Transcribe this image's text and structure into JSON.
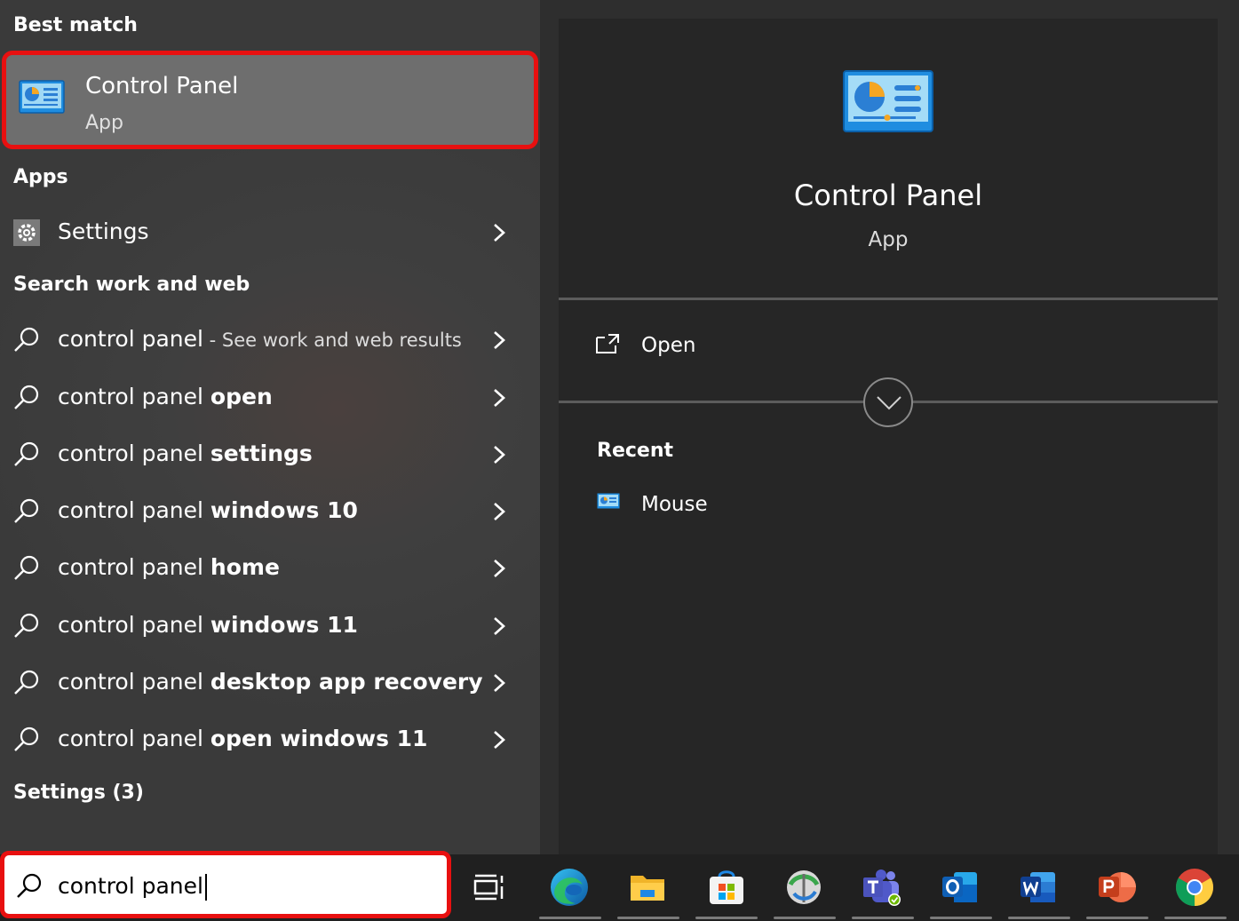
{
  "left_pane": {
    "best_match_header": "Best match",
    "best_match": {
      "title": "Control Panel",
      "subtitle": "App"
    },
    "apps_header": "Apps",
    "apps": [
      {
        "label": "Settings"
      }
    ],
    "web_header": "Search work and web",
    "web_results": [
      {
        "prefix": "control panel",
        "bold": "",
        "hint": " - See work and web results"
      },
      {
        "prefix": "control panel ",
        "bold": "open",
        "hint": ""
      },
      {
        "prefix": "control panel ",
        "bold": "settings",
        "hint": ""
      },
      {
        "prefix": "control panel ",
        "bold": "windows 10",
        "hint": ""
      },
      {
        "prefix": "control panel ",
        "bold": "home",
        "hint": ""
      },
      {
        "prefix": "control panel ",
        "bold": "windows 11",
        "hint": ""
      },
      {
        "prefix": "control panel ",
        "bold": "desktop app recovery",
        "hint": ""
      },
      {
        "prefix": "control panel ",
        "bold": "open windows 11",
        "hint": ""
      }
    ],
    "settings_header": "Settings (3)"
  },
  "preview": {
    "title": "Control Panel",
    "subtitle": "App",
    "open_label": "Open",
    "recent_header": "Recent",
    "recent_items": [
      {
        "label": "Mouse"
      }
    ]
  },
  "taskbar": {
    "search_value": "control panel",
    "apps": [
      "task-view-icon",
      "edge-icon",
      "file-explorer-icon",
      "microsoft-store-icon",
      "network-app-icon",
      "teams-icon",
      "outlook-icon",
      "word-icon",
      "powerpoint-icon",
      "chrome-icon"
    ]
  },
  "colors": {
    "highlight_border": "#e81010",
    "best_match_bg": "#6e6e6e",
    "preview_bg": "#262626",
    "taskbar_bg": "#202020"
  }
}
